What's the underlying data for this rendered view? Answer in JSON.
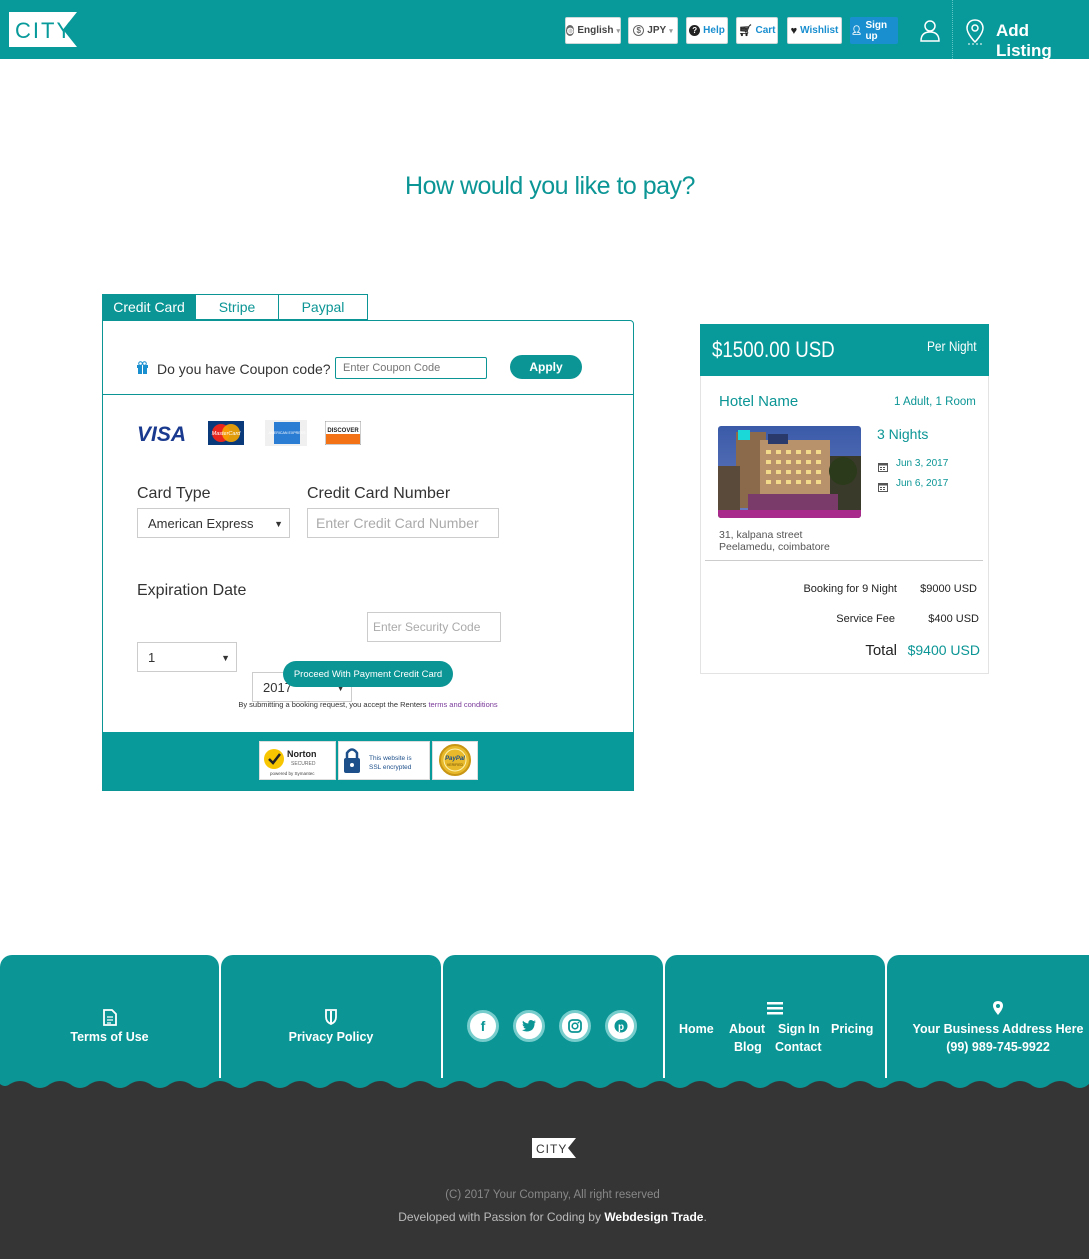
{
  "header": {
    "logo_text": "CITY",
    "language": "English",
    "currency": "JPY",
    "help": "Help",
    "cart": "Cart",
    "wishlist": "Wishlist",
    "signup": "Sign up",
    "add_listing": "Add Listing"
  },
  "page_title": "How would you like to pay?",
  "tabs": [
    "Credit Card",
    "Stripe",
    "Paypal"
  ],
  "coupon": {
    "question": "Do you have Coupon code?",
    "placeholder": "Enter Coupon Code",
    "apply": "Apply"
  },
  "card_logos": [
    "VISA",
    "MasterCard",
    "AMERICAN EXPRESS",
    "DISCOVER"
  ],
  "form": {
    "card_type_label": "Card Type",
    "card_type_value": "American Express",
    "card_number_label": "Credit Card Number",
    "card_number_placeholder": "Enter Credit Card Number",
    "expiration_label": "Expiration Date",
    "exp_month": "1",
    "exp_year": "2017",
    "security_placeholder": "Enter Security Code",
    "proceed": "Proceed With Payment Credit Card",
    "terms_prefix": "By submitting a booking request, you accept the Renters ",
    "terms_link": "terms and conditions"
  },
  "badges": {
    "norton": "Norton",
    "norton_sub": "SECURED",
    "norton_by": "powered by Symantec",
    "ssl_line1": "This website is",
    "ssl_line2": "SSL encrypted",
    "paypal": "PayPal",
    "paypal_sub": "VERIFIED"
  },
  "summary": {
    "price": "$1500.00 USD",
    "per_night": "Per Night",
    "hotel_name": "Hotel Name",
    "guests": "1 Adult, 1 Room",
    "nights": "3 Nights",
    "checkin": "Jun 3, 2017",
    "checkout": "Jun 6, 2017",
    "address_line1": "31, kalpana street",
    "address_line2": "Peelamedu, coimbatore",
    "booking_label": "Booking for 9 Night",
    "booking_value": "$9000 USD",
    "fee_label": "Service Fee",
    "fee_value": "$400 USD",
    "total_label": "Total",
    "total_value": "$9400 USD"
  },
  "footer": {
    "terms": "Terms of Use",
    "privacy": "Privacy Policy",
    "social": [
      "facebook",
      "twitter",
      "instagram",
      "pinterest"
    ],
    "nav": [
      "Home",
      "About",
      "Sign In",
      "Pricing",
      "Blog",
      "Contact"
    ],
    "address": "Your Business Address Here",
    "phone": "(99) 989-745-9922",
    "logo_text": "CITY",
    "copyright": "(C) 2017 Your Company, All right reserved",
    "developed_prefix": "Developed with Passion for Coding by ",
    "developed_by": "Webdesign Trade",
    "developed_suffix": "."
  },
  "colors": {
    "primary": "#0c9595",
    "header": "#089a9a",
    "footer_dark": "#353535",
    "signup": "#1a8fd0"
  }
}
